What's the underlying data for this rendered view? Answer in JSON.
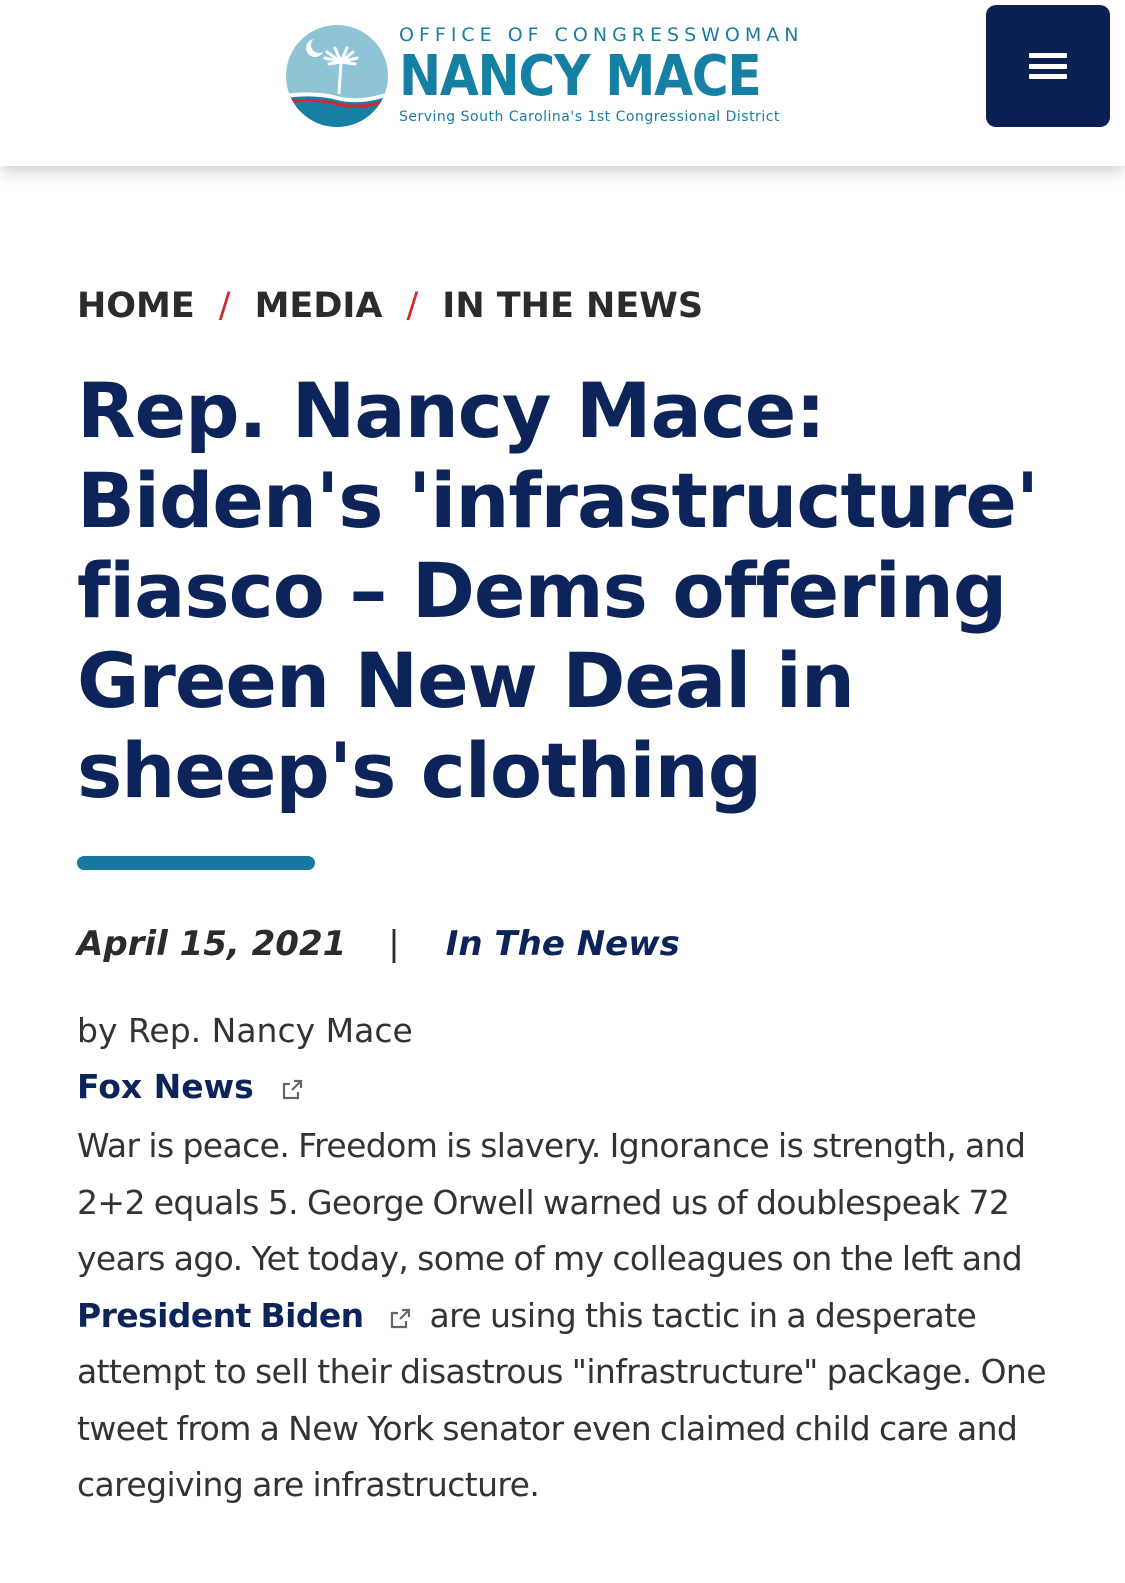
{
  "header": {
    "logo": {
      "office_line": "OFFICE OF CONGRESSWOMAN",
      "name": "NANCY MACE",
      "district_line": "Serving South Carolina's 1st Congressional District"
    },
    "menu_icon": "hamburger-menu-icon"
  },
  "colors": {
    "brand_teal": "#1680a4",
    "navy": "#0c2459",
    "menu_bg": "#0b1f52",
    "breadcrumb_separator": "#d4282d",
    "title_rule": "#17789f"
  },
  "breadcrumb": {
    "items": [
      "HOME",
      "MEDIA",
      "IN THE NEWS"
    ],
    "separator": "/"
  },
  "article": {
    "title": "Rep. Nancy Mace: Biden's 'infrastructure' fiasco – Dems offering Green New Deal in sheep's clothing",
    "date": "April 15, 2021",
    "meta_separator": "|",
    "category": "In The News",
    "byline": "by Rep. Nancy Mace",
    "source_link": "Fox News",
    "body": {
      "before_link": "War is peace. Freedom is slavery. Ignorance is strength, and 2+2 equals 5. George Orwell warned us of doublespeak 72 years ago. Yet today, some of my colleagues on the left and ",
      "link": "President Biden",
      "after_link": "are using this tactic in a desperate attempt to sell their disastrous \"infrastructure\" package. One tweet from a New York senator even claimed child care and caregiving are infrastructure."
    }
  }
}
